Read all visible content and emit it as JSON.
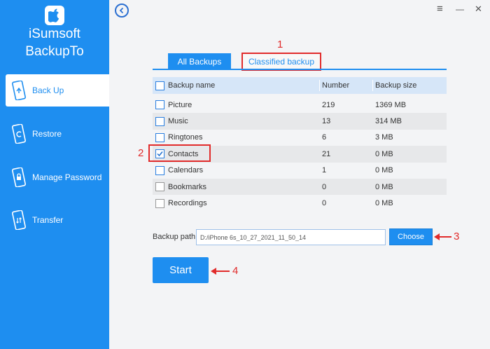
{
  "app": {
    "name_line1": "iSumsoft",
    "name_line2": "BackupTo"
  },
  "sidebar": {
    "items": [
      {
        "label": "Back Up",
        "icon": "phone-backup-icon",
        "active": true
      },
      {
        "label": "Restore",
        "icon": "phone-restore-icon",
        "active": false
      },
      {
        "label": "Manage Password",
        "icon": "phone-lock-icon",
        "active": false
      },
      {
        "label": "Transfer",
        "icon": "phone-transfer-icon",
        "active": false
      }
    ]
  },
  "window": {
    "menu_glyph": "≡",
    "minimize_glyph": "—",
    "close_glyph": "✕"
  },
  "tabs": [
    {
      "label": "All Backups",
      "active": true
    },
    {
      "label": "Classified backup",
      "active": false
    }
  ],
  "table": {
    "headers": [
      "Backup name",
      "Number",
      "Backup size"
    ],
    "rows": [
      {
        "name": "Picture",
        "number": "219",
        "size": "1369 MB",
        "checked": false
      },
      {
        "name": "Music",
        "number": "13",
        "size": "314 MB",
        "checked": false
      },
      {
        "name": "Ringtones",
        "number": "6",
        "size": "3 MB",
        "checked": false
      },
      {
        "name": "Contacts",
        "number": "21",
        "size": "0 MB",
        "checked": true
      },
      {
        "name": "Calendars",
        "number": "1",
        "size": "0 MB",
        "checked": false
      },
      {
        "name": "Bookmarks",
        "number": "0",
        "size": "0 MB",
        "checked": false
      },
      {
        "name": "Recordings",
        "number": "0",
        "size": "0 MB",
        "checked": false
      }
    ]
  },
  "backup_path": {
    "label": "Backup path",
    "value": "D:/iPhone 6s_10_27_2021_11_50_14",
    "choose_label": "Choose"
  },
  "start_label": "Start",
  "annotations": {
    "n1": "1",
    "n2": "2",
    "n3": "3",
    "n4": "4"
  },
  "colors": {
    "accent": "#1e8ef0",
    "annotation": "#e12b2b"
  }
}
